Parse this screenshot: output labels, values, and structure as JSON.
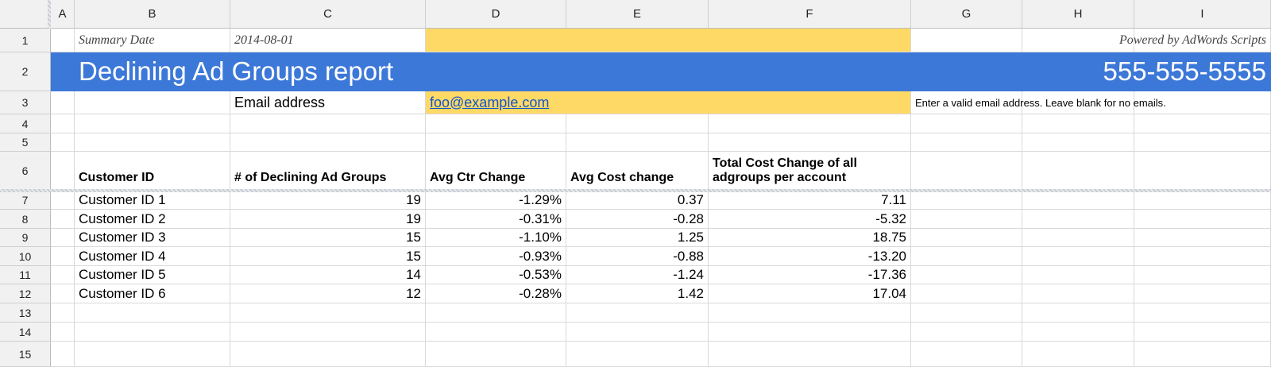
{
  "columns": [
    "A",
    "B",
    "C",
    "D",
    "E",
    "F",
    "G",
    "H",
    "I"
  ],
  "rows": [
    "1",
    "2",
    "3",
    "4",
    "5",
    "6",
    "7",
    "8",
    "9",
    "10",
    "11",
    "12",
    "13",
    "14",
    "15"
  ],
  "summary": {
    "label": "Summary Date",
    "date": "2014-08-01",
    "powered_by": "Powered by AdWords Scripts"
  },
  "banner": {
    "title": "Declining Ad Groups report",
    "phone": "555-555-5555",
    "color": "#3c78d8"
  },
  "email": {
    "label": "Email address",
    "value": "foo@example.com",
    "hint": "Enter a valid email address. Leave blank for no emails.",
    "highlight_color": "#ffd966"
  },
  "table": {
    "headers": {
      "customer_id": "Customer ID",
      "declining": "# of Declining Ad Groups",
      "avg_ctr": "Avg Ctr Change",
      "avg_cost": "Avg Cost change",
      "total_cost_line1": "Total Cost Change of all",
      "total_cost_line2": "adgroups per account"
    },
    "rows": [
      {
        "customer": "Customer ID 1",
        "declining": "19",
        "ctr": "-1.29%",
        "cost": "0.37",
        "total": "7.11"
      },
      {
        "customer": "Customer ID 2",
        "declining": "19",
        "ctr": "-0.31%",
        "cost": "-0.28",
        "total": "-5.32"
      },
      {
        "customer": "Customer ID 3",
        "declining": "15",
        "ctr": "-1.10%",
        "cost": "1.25",
        "total": "18.75"
      },
      {
        "customer": "Customer ID 4",
        "declining": "15",
        "ctr": "-0.93%",
        "cost": "-0.88",
        "total": "-13.20"
      },
      {
        "customer": "Customer ID 5",
        "declining": "14",
        "ctr": "-0.53%",
        "cost": "-1.24",
        "total": "-17.36"
      },
      {
        "customer": "Customer ID 6",
        "declining": "12",
        "ctr": "-0.28%",
        "cost": "1.42",
        "total": "17.04"
      }
    ]
  }
}
